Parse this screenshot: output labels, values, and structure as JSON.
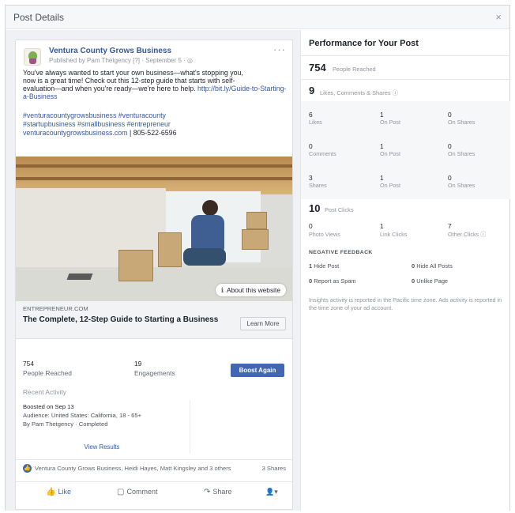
{
  "dialog": {
    "title": "Post Details",
    "close_glyph": "×"
  },
  "post": {
    "page_name": "Ventura County Grows Business",
    "byline": "Published by Pam Thetgency [?] · September 5 · ◎",
    "text_lines": [
      "You've always wanted to start your own business—what's stopping you,",
      "now is a great time! Check out this 12-step guide that starts with self-",
      "evaluation—and when you're ready—we're here to help."
    ],
    "text_link": "http://bit.ly/Guide-to-Starting-a-Business",
    "hashtag_lines": [
      "#venturacountygrowsbusiness #venturacounty",
      "#startupbusiness #smallbusiness #entrepreneur"
    ],
    "contact_link": "venturacountygrowsbusiness.com",
    "contact_phone": " | 805-522-6596",
    "about_label": "About this website",
    "link_domain": "ENTREPRENEUR.COM",
    "link_title": "The Complete, 12-Step Guide to Starting a Business",
    "cta_label": "Learn More"
  },
  "metrics": {
    "reach_value": "754",
    "reach_label": "People Reached",
    "engagement_value": "19",
    "engagement_label": "Engagements",
    "boost_label": "Boost Again"
  },
  "recent": {
    "title": "Recent Activity",
    "line1": "Boosted on Sep 13",
    "line2": "Audience: United States: California, 18 - 65+",
    "line3": "By Pam Thetgency · Completed",
    "view_results": "View Results"
  },
  "reactions": {
    "icon_glyph": "👍",
    "names": "Ventura County Grows Business, Heidi Hayes, Matt Kingsley and 3 others",
    "shares": "3 Shares"
  },
  "actions": {
    "like": "Like",
    "comment": "Comment",
    "share": "Share",
    "audience_glyph": "👤▾"
  },
  "performance": {
    "title": "Performance for Your Post",
    "reached_value": "754",
    "reached_label": "People Reached",
    "lcs_value": "9",
    "lcs_label": "Likes, Comments & Shares ⓘ",
    "grid": [
      [
        {
          "num": "6",
          "lbl": "Likes"
        },
        {
          "num": "1",
          "lbl": "On Post"
        },
        {
          "num": "0",
          "lbl": "On Shares"
        }
      ],
      [
        {
          "num": "0",
          "lbl": "Comments"
        },
        {
          "num": "1",
          "lbl": "On Post"
        },
        {
          "num": "0",
          "lbl": "On Shares"
        }
      ],
      [
        {
          "num": "3",
          "lbl": "Shares"
        },
        {
          "num": "1",
          "lbl": "On Post"
        },
        {
          "num": "0",
          "lbl": "On Shares"
        }
      ]
    ],
    "clicks_value": "10",
    "clicks_label": "Post Clicks",
    "clicks_grid": [
      {
        "num": "0",
        "lbl": "Photo Views"
      },
      {
        "num": "1",
        "lbl": "Link Clicks"
      },
      {
        "num": "7",
        "lbl": "Other Clicks ⓘ"
      }
    ],
    "negative_title": "NEGATIVE FEEDBACK",
    "negative": [
      {
        "num": "1",
        "lbl": "Hide Post"
      },
      {
        "num": "0",
        "lbl": "Hide All Posts"
      },
      {
        "num": "0",
        "lbl": "Report as Spam"
      },
      {
        "num": "0",
        "lbl": "Unlike Page"
      }
    ],
    "note": "Insights activity is reported in the Pacific time zone. Ads activity is reported in the time zone of your ad account."
  }
}
